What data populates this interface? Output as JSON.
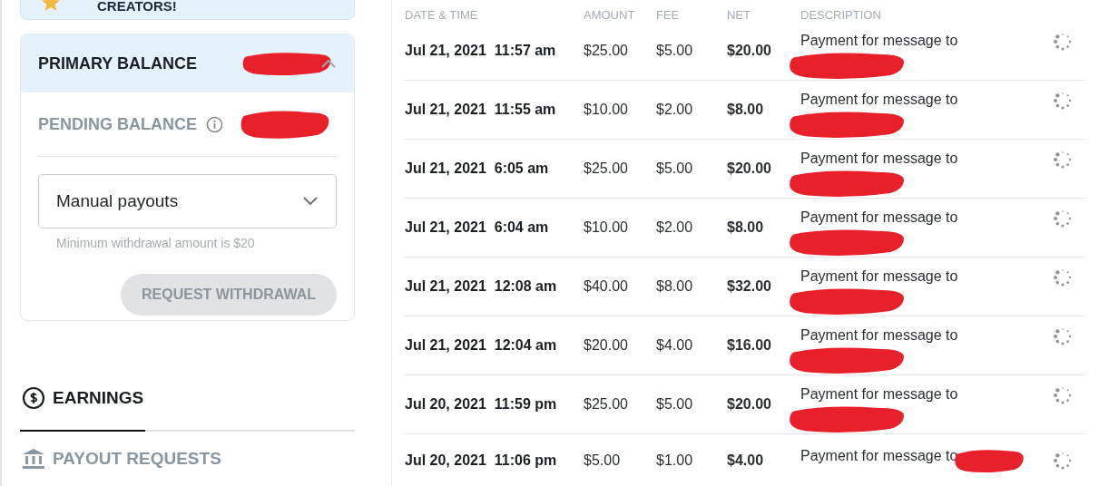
{
  "banner": {
    "text": "CREATORS!"
  },
  "balance": {
    "primary": {
      "label": "PRIMARY BALANCE",
      "redacted": true,
      "expanded": true
    },
    "pending": {
      "label": "PENDING BALANCE",
      "redacted": true
    },
    "payout_select": {
      "value": "Manual payouts"
    },
    "hint": "Minimum withdrawal amount is $20",
    "request_button": {
      "label": "REQUEST WITHDRAWAL",
      "disabled": true
    }
  },
  "tabs": [
    {
      "label": "EARNINGS",
      "selected": true
    },
    {
      "label": "PAYOUT REQUESTS",
      "selected": false
    }
  ],
  "table": {
    "columns": [
      "DATE & TIME",
      "AMOUNT",
      "FEE",
      "NET",
      "DESCRIPTION"
    ],
    "rows": [
      {
        "date": "Jul 21, 2021",
        "time": "11:57 am",
        "amount": "$25.00",
        "fee": "$5.00",
        "net": "$20.00",
        "description": "Payment for message to",
        "kind": "stacked",
        "redacted": true
      },
      {
        "date": "Jul 21, 2021",
        "time": "11:55 am",
        "amount": "$10.00",
        "fee": "$2.00",
        "net": "$8.00",
        "description": "Payment for message to",
        "kind": "stacked",
        "redacted": true
      },
      {
        "date": "Jul 21, 2021",
        "time": "6:05 am",
        "amount": "$25.00",
        "fee": "$5.00",
        "net": "$20.00",
        "description": "Payment for message to",
        "kind": "stacked",
        "redacted": true
      },
      {
        "date": "Jul 21, 2021",
        "time": "6:04 am",
        "amount": "$10.00",
        "fee": "$2.00",
        "net": "$8.00",
        "description": "Payment for message to",
        "kind": "stacked",
        "redacted": true
      },
      {
        "date": "Jul 21, 2021",
        "time": "12:08 am",
        "amount": "$40.00",
        "fee": "$8.00",
        "net": "$32.00",
        "description": "Payment for message to",
        "kind": "stacked",
        "redacted": true
      },
      {
        "date": "Jul 21, 2021",
        "time": "12:04 am",
        "amount": "$20.00",
        "fee": "$4.00",
        "net": "$16.00",
        "description": "Payment for message to",
        "kind": "stacked",
        "redacted": true
      },
      {
        "date": "Jul 20, 2021",
        "time": "11:59 pm",
        "amount": "$25.00",
        "fee": "$5.00",
        "net": "$20.00",
        "description": "Payment for message to",
        "kind": "stacked",
        "redacted": true
      },
      {
        "date": "Jul 20, 2021",
        "time": "11:06 pm",
        "amount": "$5.00",
        "fee": "$1.00",
        "net": "$4.00",
        "description": "Payment for message to",
        "kind": "inline",
        "redacted": true
      }
    ]
  }
}
